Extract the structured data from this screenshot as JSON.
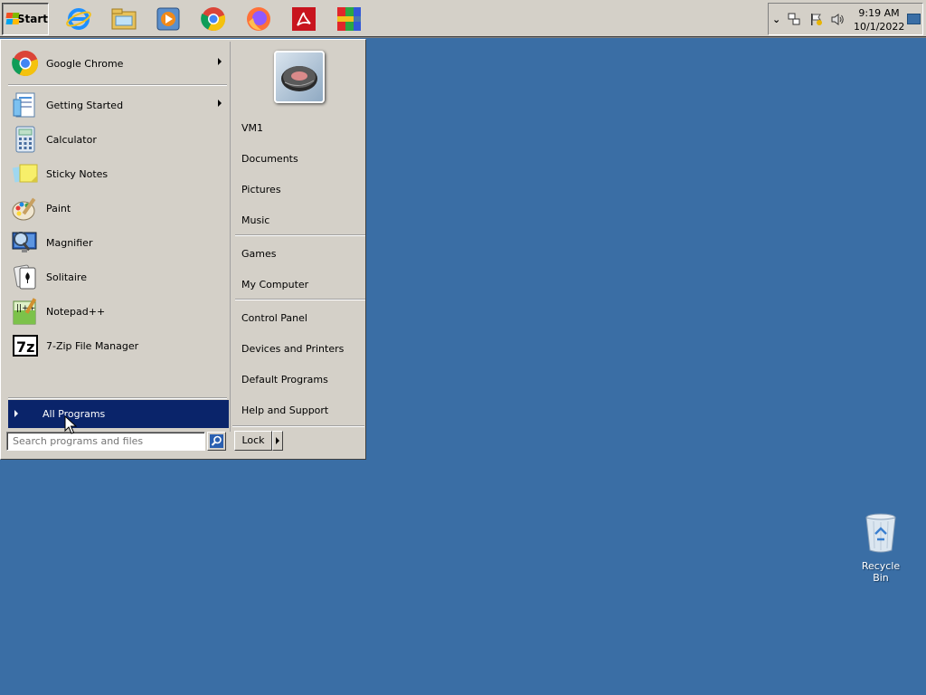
{
  "taskbar": {
    "start_label": "Start",
    "quick_launch": [
      {
        "icon": "internet-explorer-icon"
      },
      {
        "icon": "file-explorer-icon"
      },
      {
        "icon": "media-player-icon"
      },
      {
        "icon": "chrome-icon"
      },
      {
        "icon": "firefox-icon"
      },
      {
        "icon": "acrobat-icon"
      },
      {
        "icon": "winrar-icon"
      }
    ],
    "clock": {
      "time": "9:19 AM",
      "date": "10/1/2022"
    }
  },
  "start_menu": {
    "pinned": [
      {
        "label": "Google Chrome",
        "icon": "chrome-icon",
        "has_submenu": true
      }
    ],
    "recent": [
      {
        "label": "Getting Started",
        "icon": "getting-started-icon",
        "has_submenu": true
      },
      {
        "label": "Calculator",
        "icon": "calculator-icon",
        "has_submenu": false
      },
      {
        "label": "Sticky Notes",
        "icon": "sticky-notes-icon",
        "has_submenu": false
      },
      {
        "label": "Paint",
        "icon": "paint-icon",
        "has_submenu": false
      },
      {
        "label": "Magnifier",
        "icon": "magnifier-icon",
        "has_submenu": false
      },
      {
        "label": "Solitaire",
        "icon": "solitaire-icon",
        "has_submenu": false
      },
      {
        "label": "Notepad++",
        "icon": "notepadpp-icon",
        "has_submenu": false
      },
      {
        "label": "7-Zip File Manager",
        "icon": "7zip-icon",
        "has_submenu": false
      }
    ],
    "all_programs_label": "All Programs",
    "search_placeholder": "Search programs and files",
    "places_group1": [
      "VM1",
      "Documents",
      "Pictures",
      "Music"
    ],
    "places_group2": [
      "Games",
      "My Computer"
    ],
    "places_group3": [
      "Control Panel",
      "Devices and Printers",
      "Default Programs",
      "Help and Support"
    ],
    "lock_label": "Lock"
  },
  "desktop": {
    "icons": [
      {
        "label": "Recycle Bin",
        "icon": "recycle-bin-icon"
      }
    ]
  },
  "colors": {
    "desktop": "#3a6ea5",
    "face": "#d4d0c8",
    "highlight": "#0a246a"
  }
}
